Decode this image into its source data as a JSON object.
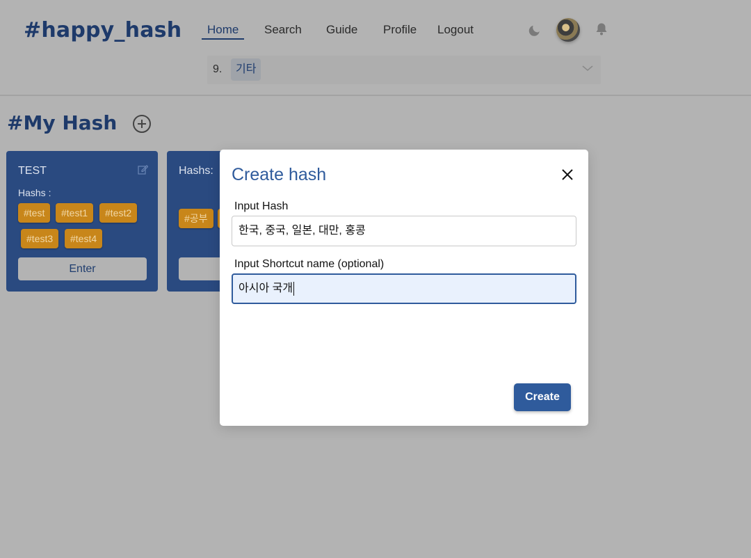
{
  "app": {
    "logo": "#happy_hash"
  },
  "nav": {
    "items": [
      {
        "label": "Home",
        "active": true
      },
      {
        "label": "Search",
        "active": false
      },
      {
        "label": "Guide",
        "active": false
      },
      {
        "label": "Profile",
        "active": false
      },
      {
        "label": "Logout",
        "active": false
      }
    ],
    "icons": [
      "moon-icon",
      "avatar",
      "bell-icon"
    ]
  },
  "category_select": {
    "number": "9.",
    "selected": "기타"
  },
  "section": {
    "title": "#My Hash"
  },
  "cards": [
    {
      "title": "TEST",
      "hash_label": "Hashs :",
      "tags": [
        "#test",
        "#test1",
        "#test2",
        "#test3",
        "#test4"
      ],
      "enter_label": "Enter"
    },
    {
      "title": "Hashs:",
      "tags": [
        "#공부"
      ]
    }
  ],
  "modal": {
    "title": "Create hash",
    "hash_label": "Input Hash",
    "hash_value": "한국, 중국, 일본, 대만, 홍콩",
    "shortcut_label": "Input Shortcut name (optional)",
    "shortcut_value": "아시아 국개",
    "create_label": "Create"
  },
  "colors": {
    "brand": "#2f5b9c",
    "card_bg": "#2a4a80",
    "tag_bg": "#c8861a",
    "overlay": "#b3b3b3"
  }
}
